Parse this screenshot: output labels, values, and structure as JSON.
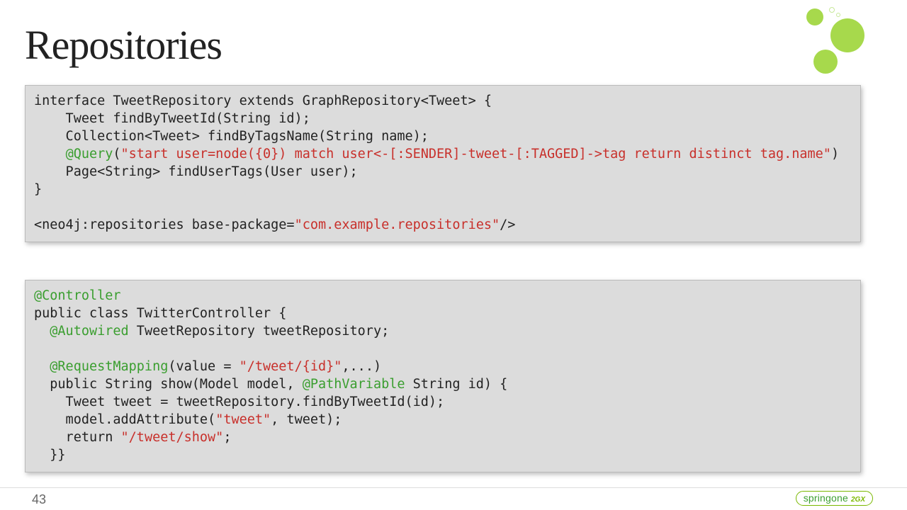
{
  "title": "Repositories",
  "code1": {
    "l1a": "interface TweetRepository extends GraphRepository<Tweet> {",
    "l2a": "    Tweet findByTweetId(String id);",
    "l3a": "    Collection<Tweet> findByTagsName(String name);",
    "l4_indent": "    ",
    "l4_ann": "@Query",
    "l4_open": "(",
    "l4_str": "\"start user=node({0}) match user<-[:SENDER]-tweet-[:TAGGED]->tag return distinct tag.name\"",
    "l4_close": ")",
    "l5a": "    Page<String> findUserTags(User user);",
    "l6a": "}",
    "l8_pre": "<neo4j:repositories base-package=",
    "l8_str": "\"com.example.repositories\"",
    "l8_post": "/>"
  },
  "code2": {
    "l1_ann": "@Controller",
    "l2a": "public class TwitterController {",
    "l3_indent": "  ",
    "l3_ann": "@Autowired",
    "l3_rest": " TweetRepository tweetRepository;",
    "l5_indent": "  ",
    "l5_ann": "@RequestMapping",
    "l5_open": "(value = ",
    "l5_str": "\"/tweet/{id}\"",
    "l5_close": ",...)",
    "l6_pre": "  public String show(Model model, ",
    "l6_ann": "@PathVariable",
    "l6_post": " String id) {",
    "l7a": "    Tweet tweet = tweetRepository.findByTweetId(id);",
    "l8_pre": "    model.addAttribute(",
    "l8_str": "\"tweet\"",
    "l8_post": ", tweet);",
    "l9_pre": "    return ",
    "l9_str": "\"/tweet/show\"",
    "l9_post": ";",
    "l10a": "  }}"
  },
  "page": "43",
  "badge_brand": "springone",
  "badge_sub": "2GX"
}
